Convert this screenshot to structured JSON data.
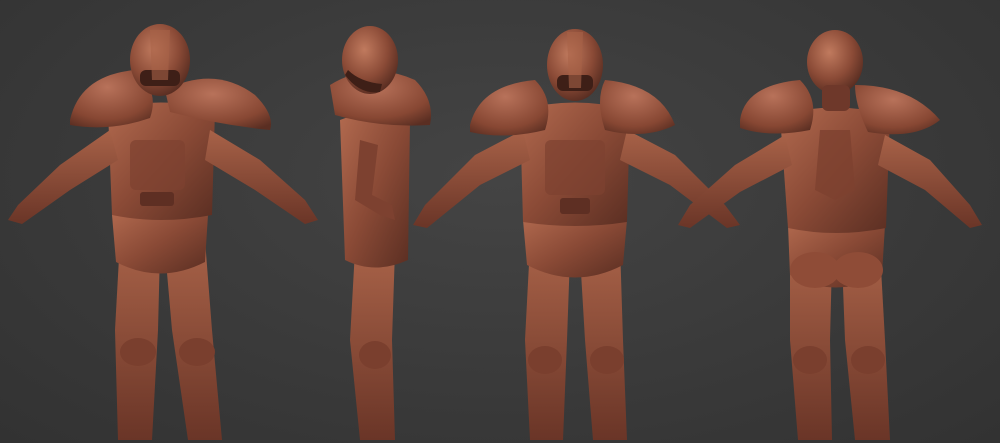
{
  "scene": {
    "background_color": "#3a3a3a",
    "clay_color": "#8a4a36",
    "clay_highlight": "#b26a4f",
    "clay_shadow": "#5a2e22"
  },
  "views": [
    {
      "view": "front-left"
    },
    {
      "view": "side"
    },
    {
      "view": "front"
    },
    {
      "view": "back"
    }
  ]
}
